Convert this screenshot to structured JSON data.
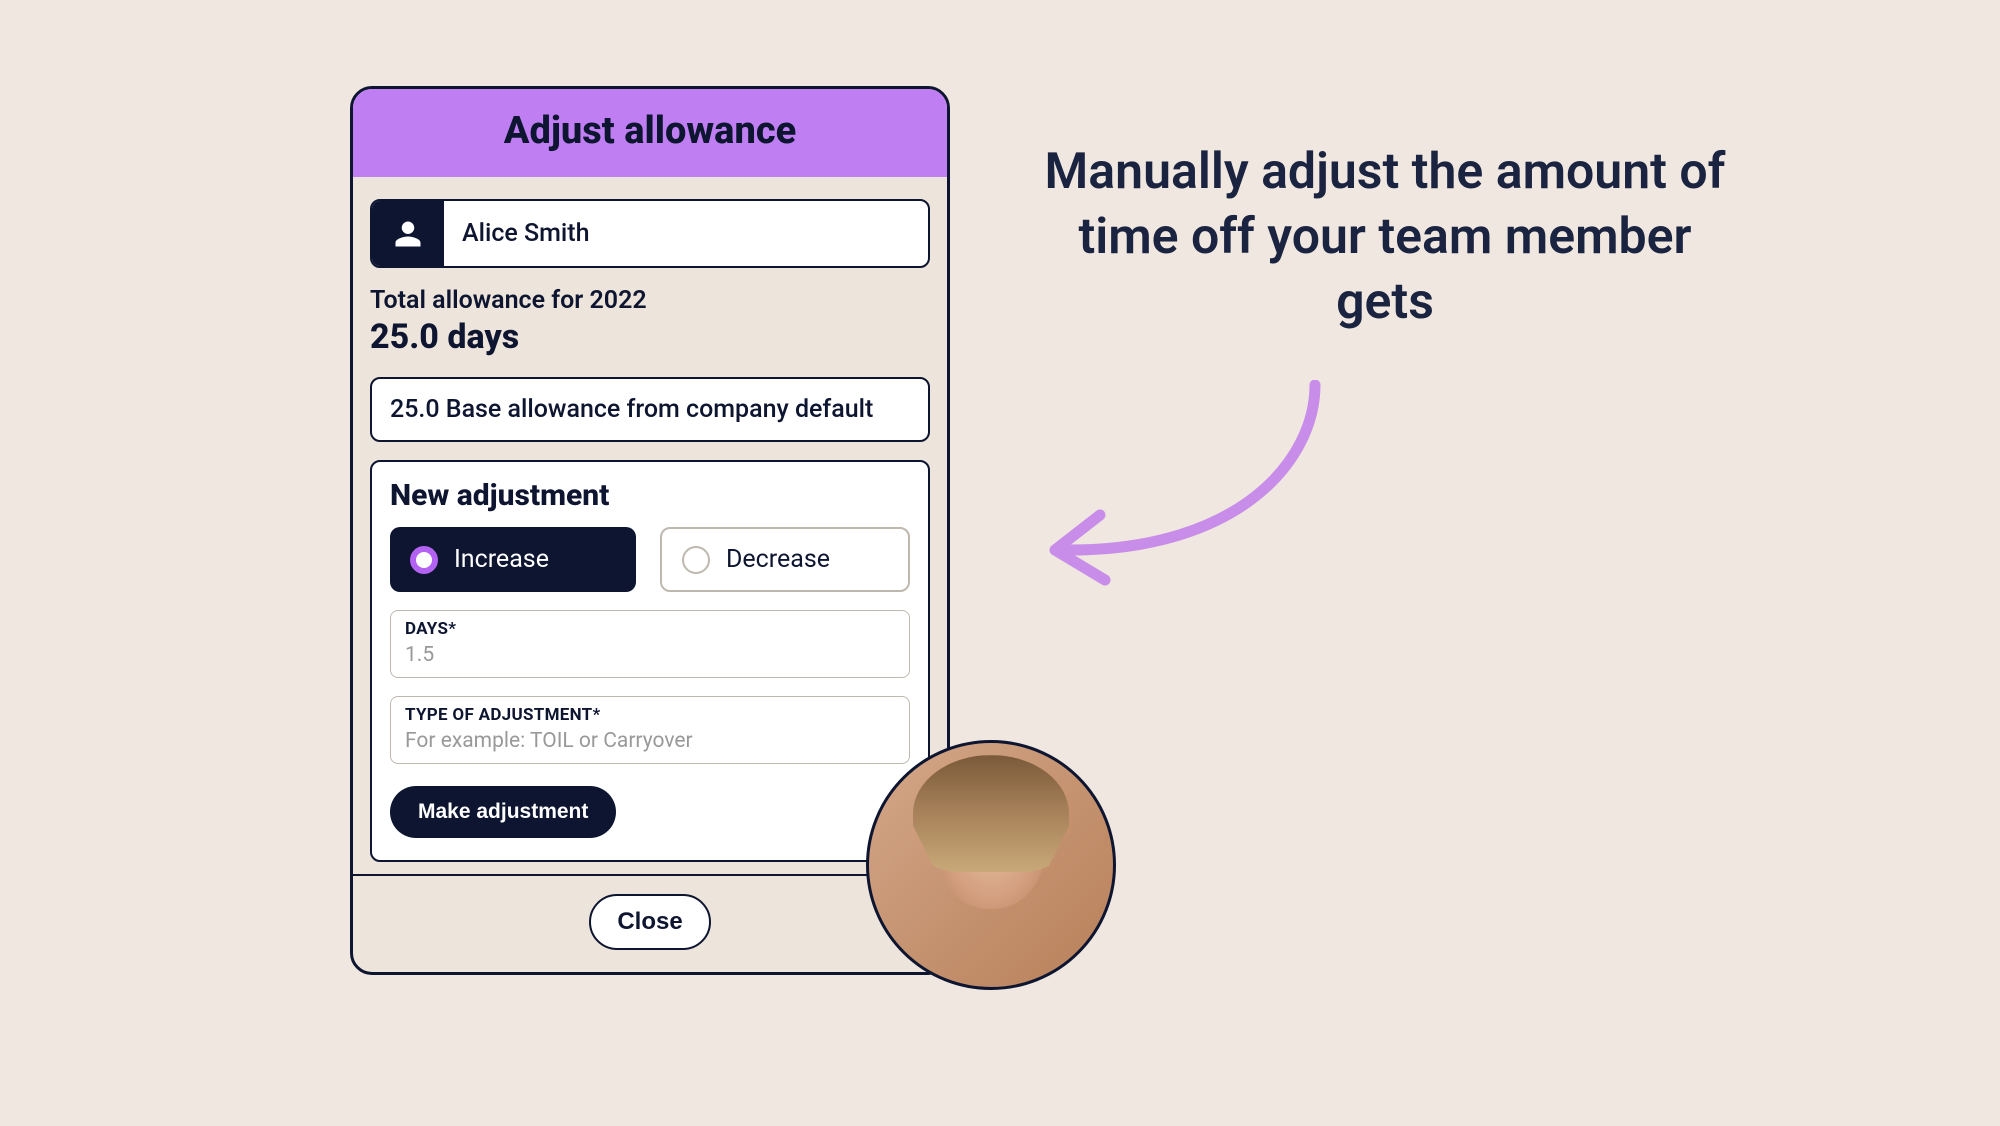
{
  "callout": "Manually adjust the amount of time off your team member gets",
  "modal": {
    "title": "Adjust allowance",
    "person_name": "Alice Smith",
    "allowance_label": "Total allowance for 2022",
    "allowance_value": "25.0 days",
    "base_allowance": "25.0 Base allowance from company default",
    "adjustment": {
      "heading": "New adjustment",
      "increase_label": "Increase",
      "decrease_label": "Decrease",
      "days_label": "DAYS*",
      "days_placeholder": "1.5",
      "type_label": "TYPE OF ADJUSTMENT*",
      "type_placeholder": "For example: TOIL or Carryover",
      "submit_label": "Make adjustment"
    },
    "close_label": "Close"
  },
  "colors": {
    "accent_purple": "#c07ef3",
    "arrow_purple": "#c88de9",
    "dark": "#0d1530",
    "bg": "#f0e7e0"
  }
}
